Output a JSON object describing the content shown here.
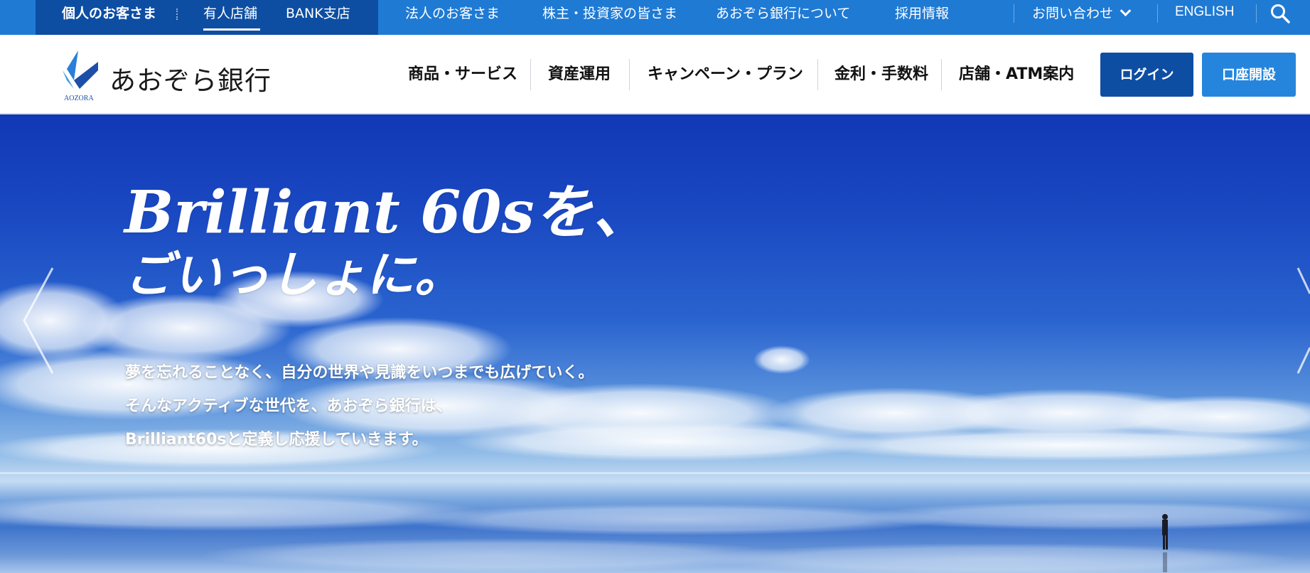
{
  "topbar": {
    "personal_label": "個人のお客さま",
    "branch_label": "有人店舗",
    "bank_branch_label": "BANK支店",
    "corporate_label": "法人のお客さま",
    "investors_label": "株主・投資家の皆さま",
    "about_label": "あおぞら銀行について",
    "recruit_label": "採用情報",
    "contact_label": "お問い合わせ",
    "english_label": "ENGLISH",
    "search_icon": "search-icon"
  },
  "header": {
    "logo_text": "あおぞら銀行",
    "logo_sub": "AOZORA",
    "nav": [
      {
        "label": "商品・サービス"
      },
      {
        "label": "資産運用"
      },
      {
        "label": "キャンペーン・プラン"
      },
      {
        "label": "金利・手数料"
      },
      {
        "label": "店舗・ATM案内"
      }
    ],
    "login_label": "ログイン",
    "open_account_label": "口座開設"
  },
  "hero": {
    "headline_line1": "Brilliant 60sを、",
    "headline_line2": "ごいっしょに。",
    "body": [
      "夢を忘れることなく、自分の世界や見識をいつまでも広げていく。",
      "そんなアクティブな世代を、あおぞら銀行は、",
      "Brilliant60sと定義し応援していきます。"
    ]
  },
  "colors": {
    "topbar_bg": "#1f7ad4",
    "personal_bg": "#0d4ea3",
    "login_bg": "#0d4ea3",
    "open_account_bg": "#2585dd"
  }
}
